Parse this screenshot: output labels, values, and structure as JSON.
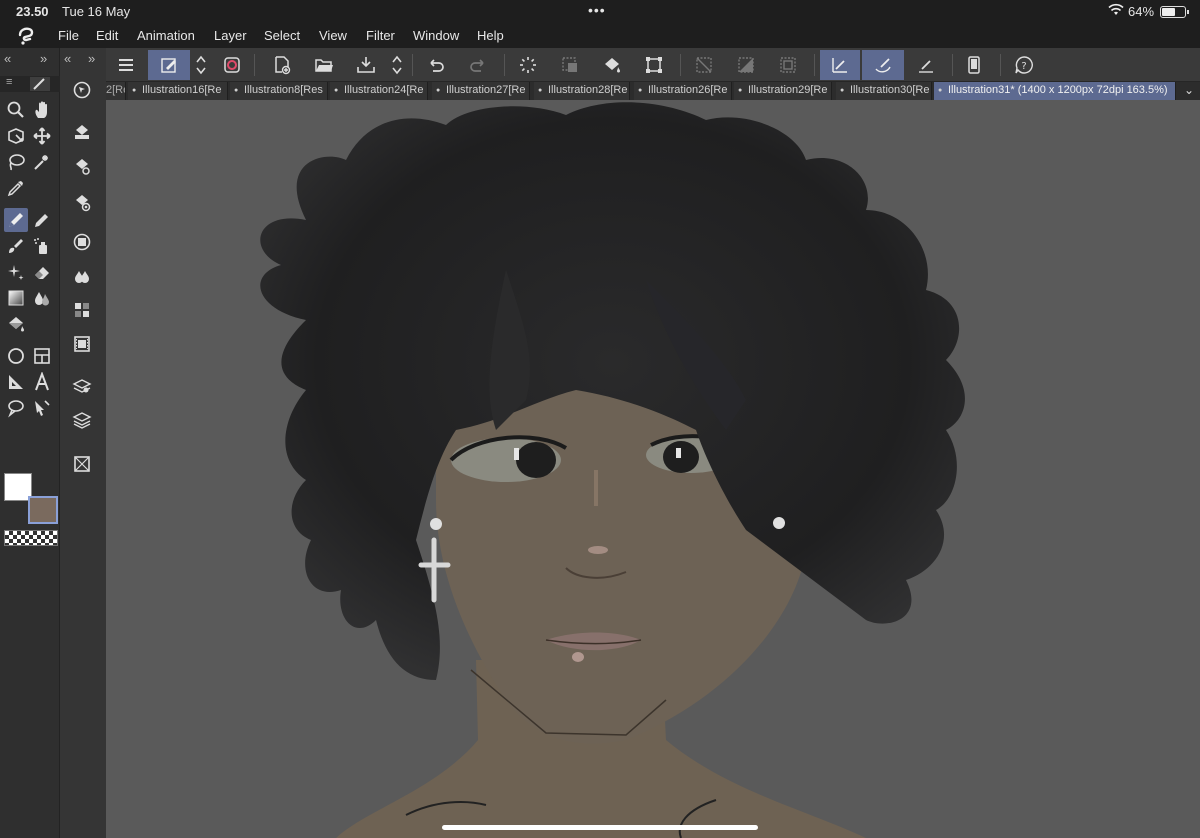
{
  "status": {
    "time": "23.50",
    "date": "Tue 16 May",
    "battery": "64%",
    "battery_level": 0.64
  },
  "menu": {
    "items": [
      "File",
      "Edit",
      "Animation",
      "Layer",
      "Select",
      "View",
      "Filter",
      "Window",
      "Help"
    ]
  },
  "tabs": {
    "first_partial": "2[Re",
    "items": [
      "Illustration16[Re",
      "Illustration8[Res",
      "Illustration24[Re",
      "Illustration27[Re",
      "Illustration28[Re",
      "Illustration26[Re",
      "Illustration29[Re",
      "Illustration30[Re",
      "Illustration31* (1400 x 1200px 72dpi 163.5%)"
    ],
    "active_index": 8
  },
  "colors": {
    "main_color": "#ffffff",
    "sub_color": "#7a6a5e",
    "accent": "#5d6a91",
    "canvas_bg": "#5a5a5a"
  },
  "icons": {
    "app": "clip-studio-icon",
    "tools": [
      "zoom-icon",
      "hand-icon",
      "transform-icon",
      "move-icon",
      "lasso-icon",
      "magic-wand-icon",
      "eyedropper-icon",
      "pen-icon",
      "pencil-icon",
      "brush-icon",
      "airbrush-icon",
      "decoration-icon",
      "eraser-icon",
      "gradient-icon",
      "blend-icon",
      "fill-icon",
      "figure-icon",
      "frame-icon",
      "ruler-icon",
      "text-icon",
      "balloon-icon",
      "correction-icon"
    ]
  }
}
